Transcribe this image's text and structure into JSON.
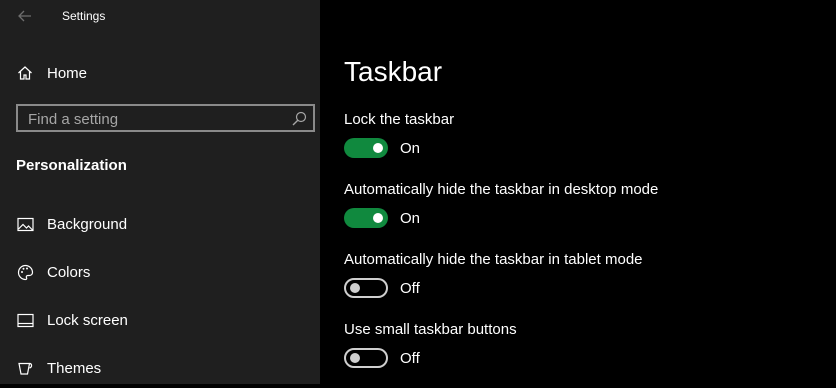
{
  "app": {
    "title": "Settings"
  },
  "sidebar": {
    "home_label": "Home",
    "search": {
      "placeholder": "Find a setting"
    },
    "section_title": "Personalization",
    "items": [
      {
        "label": "Background",
        "icon": "image-icon"
      },
      {
        "label": "Colors",
        "icon": "palette-icon"
      },
      {
        "label": "Lock screen",
        "icon": "lock-screen-icon"
      },
      {
        "label": "Themes",
        "icon": "themes-icon"
      }
    ]
  },
  "main": {
    "title": "Taskbar",
    "settings": [
      {
        "label": "Lock the taskbar",
        "state": "On",
        "on": true
      },
      {
        "label": "Automatically hide the taskbar in desktop mode",
        "state": "On",
        "on": true
      },
      {
        "label": "Automatically hide the taskbar in tablet mode",
        "state": "Off",
        "on": false
      },
      {
        "label": "Use small taskbar buttons",
        "state": "Off",
        "on": false
      }
    ]
  },
  "colors": {
    "accent_on": "#10893e",
    "sidebar_bg": "#1f1f1f",
    "main_bg": "#000000"
  }
}
